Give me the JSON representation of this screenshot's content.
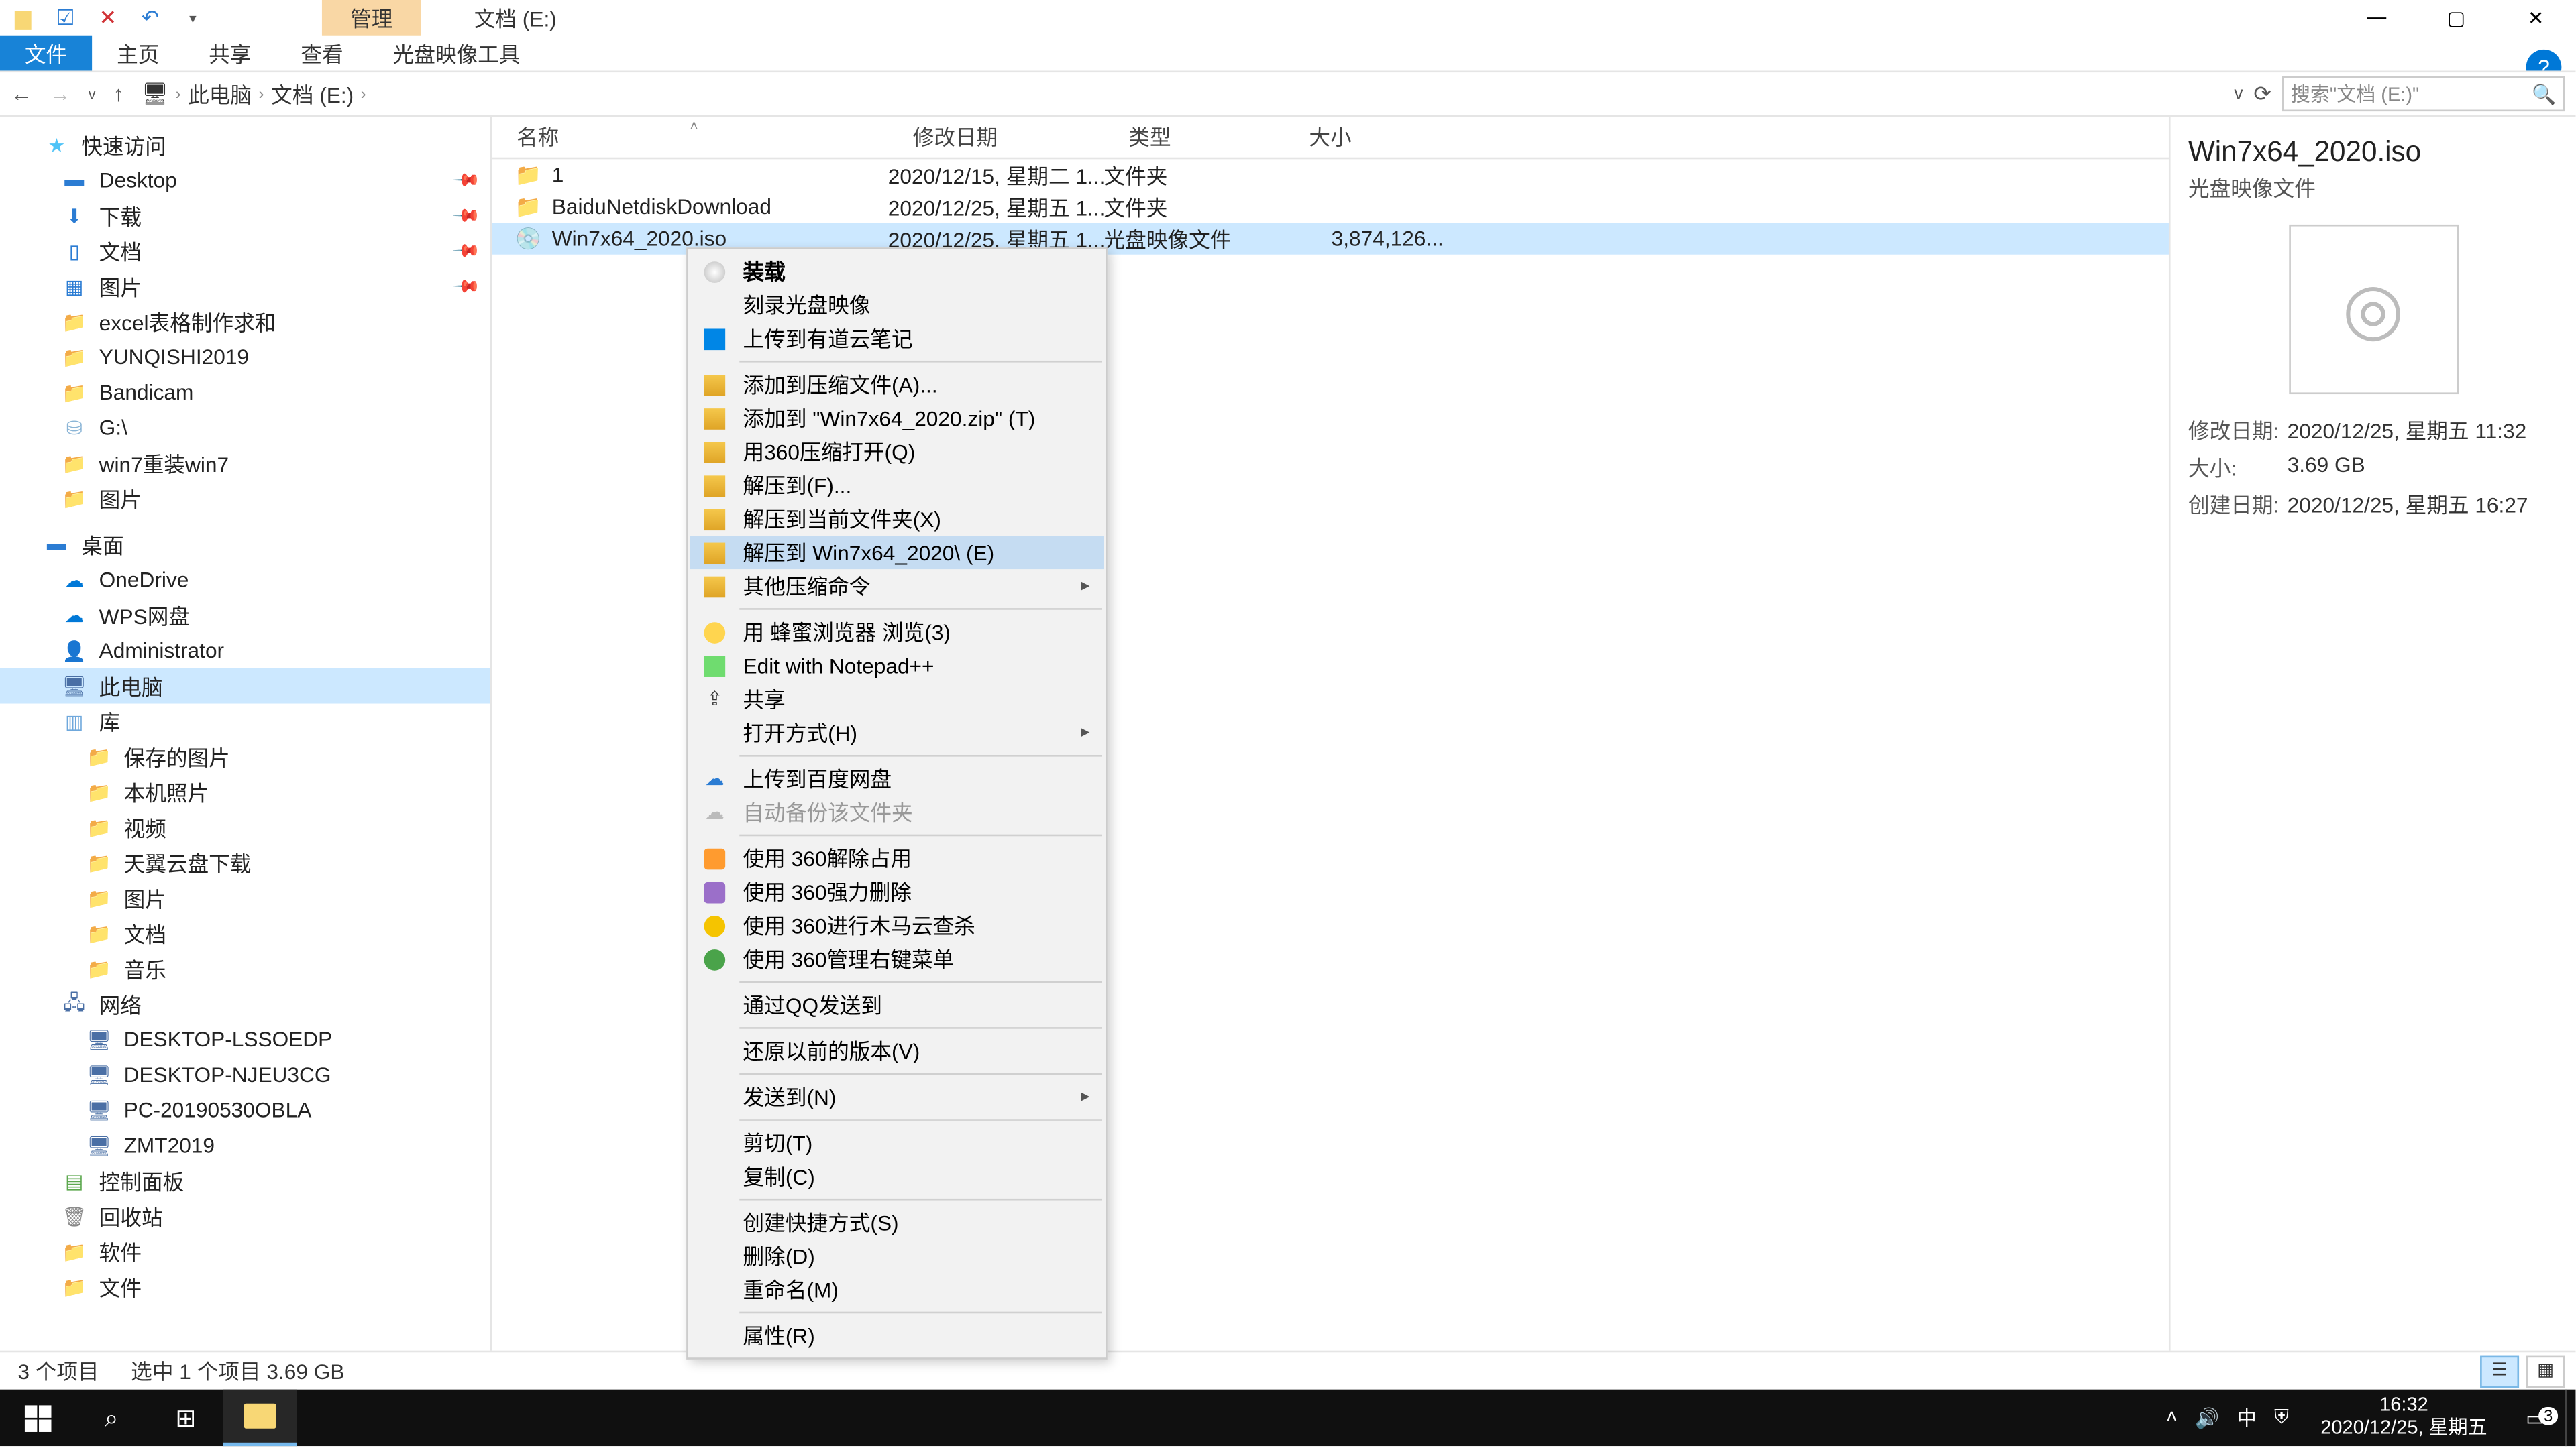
{
  "title": "文档 (E:)",
  "qat": {
    "undo_glyph": "↶",
    "redo_glyph": "↷"
  },
  "top_tabs": {
    "manage": "管理"
  },
  "ribbon": {
    "file": "文件",
    "home": "主页",
    "share": "共享",
    "view": "查看",
    "disc_tool": "光盘映像工具"
  },
  "win_controls": {
    "min": "—",
    "max": "▢",
    "close": "✕",
    "help": "?"
  },
  "nav_arrows": {
    "back": "←",
    "fwd": "→",
    "up": "↑"
  },
  "breadcrumb": {
    "root_icon": "🖥",
    "sep": "›",
    "pc": "此电脑",
    "drive": "文档 (E:)"
  },
  "address_right": {
    "chevron": "v",
    "refresh": "⟳"
  },
  "search_placeholder": "搜索\"文档 (E:)\"",
  "nav": {
    "quick": "快速访问",
    "desktop": "Desktop",
    "downloads": "下载",
    "documents": "文档",
    "pictures": "图片",
    "excel": "excel表格制作求和",
    "yunqishi": "YUNQISHI2019",
    "bandicam": "Bandicam",
    "gdrive": "G:\\",
    "win7re": "win7重装win7",
    "pictures2": "图片",
    "desktop_cn": "桌面",
    "onedrive": "OneDrive",
    "wps": "WPS网盘",
    "admin": "Administrator",
    "thispc": "此电脑",
    "lib": "库",
    "saved_pics": "保存的图片",
    "local_pics": "本机照片",
    "videos": "视频",
    "tianyi": "天翼云盘下载",
    "pictures3": "图片",
    "documents2": "文档",
    "music": "音乐",
    "network": "网络",
    "pc1": "DESKTOP-LSSOEDP",
    "pc2": "DESKTOP-NJEU3CG",
    "pc3": "PC-20190530OBLA",
    "pc4": "ZMT2019",
    "control": "控制面板",
    "recycle": "回收站",
    "software": "软件",
    "files": "文件"
  },
  "columns": {
    "name": "名称",
    "date": "修改日期",
    "type": "类型",
    "size": "大小"
  },
  "rows": [
    {
      "icon": "📁",
      "name": "1",
      "date": "2020/12/15, 星期二 1...",
      "type": "文件夹",
      "size": ""
    },
    {
      "icon": "📁",
      "name": "BaiduNetdiskDownload",
      "date": "2020/12/25, 星期五 1...",
      "type": "文件夹",
      "size": ""
    },
    {
      "icon": "💿",
      "name": "Win7x64_2020.iso",
      "date": "2020/12/25, 星期五 1...",
      "type": "光盘映像文件",
      "size": "3,874,126..."
    }
  ],
  "details": {
    "title": "Win7x64_2020.iso",
    "subtitle": "光盘映像文件",
    "thumb_glyph": "◎",
    "mod_label": "修改日期:",
    "mod_val": "2020/12/25, 星期五 11:32",
    "size_label": "大小:",
    "size_val": "3.69 GB",
    "create_label": "创建日期:",
    "create_val": "2020/12/25, 星期五 16:27"
  },
  "ctx": {
    "mount": "装载",
    "burn": "刻录光盘映像",
    "youdao": "上传到有道云笔记",
    "add_archive": "添加到压缩文件(A)...",
    "add_zip": "添加到 \"Win7x64_2020.zip\" (T)",
    "open_360zip": "用360压缩打开(Q)",
    "extract_to": "解压到(F)...",
    "extract_here": "解压到当前文件夹(X)",
    "extract_named": "解压到 Win7x64_2020\\ (E)",
    "other_zip": "其他压缩命令",
    "bee": "用 蜂蜜浏览器 浏览(3)",
    "notepad": "Edit with Notepad++",
    "share": "共享",
    "open_with": "打开方式(H)",
    "baidu": "上传到百度网盘",
    "auto_backup": "自动备份该文件夹",
    "unlock360": "使用 360解除占用",
    "force_del": "使用 360强力删除",
    "trojan": "使用 360进行木马云查杀",
    "manage_ctx": "使用 360管理右键菜单",
    "qq_send": "通过QQ发送到",
    "restore": "还原以前的版本(V)",
    "send_to": "发送到(N)",
    "cut": "剪切(T)",
    "copy": "复制(C)",
    "shortcut": "创建快捷方式(S)",
    "delete": "删除(D)",
    "rename": "重命名(M)",
    "properties": "属性(R)"
  },
  "status": {
    "count": "3 个项目",
    "selected": "选中 1 个项目  3.69 GB"
  },
  "taskbar": {
    "search_glyph": "⌕",
    "taskview_glyph": "⊞",
    "tray_up": "˄",
    "vol": "🔊",
    "ime": "中",
    "shield": "⛨",
    "time": "16:32",
    "date": "2020/12/25, 星期五",
    "notif_glyph": "▭",
    "notif_count": "3"
  }
}
